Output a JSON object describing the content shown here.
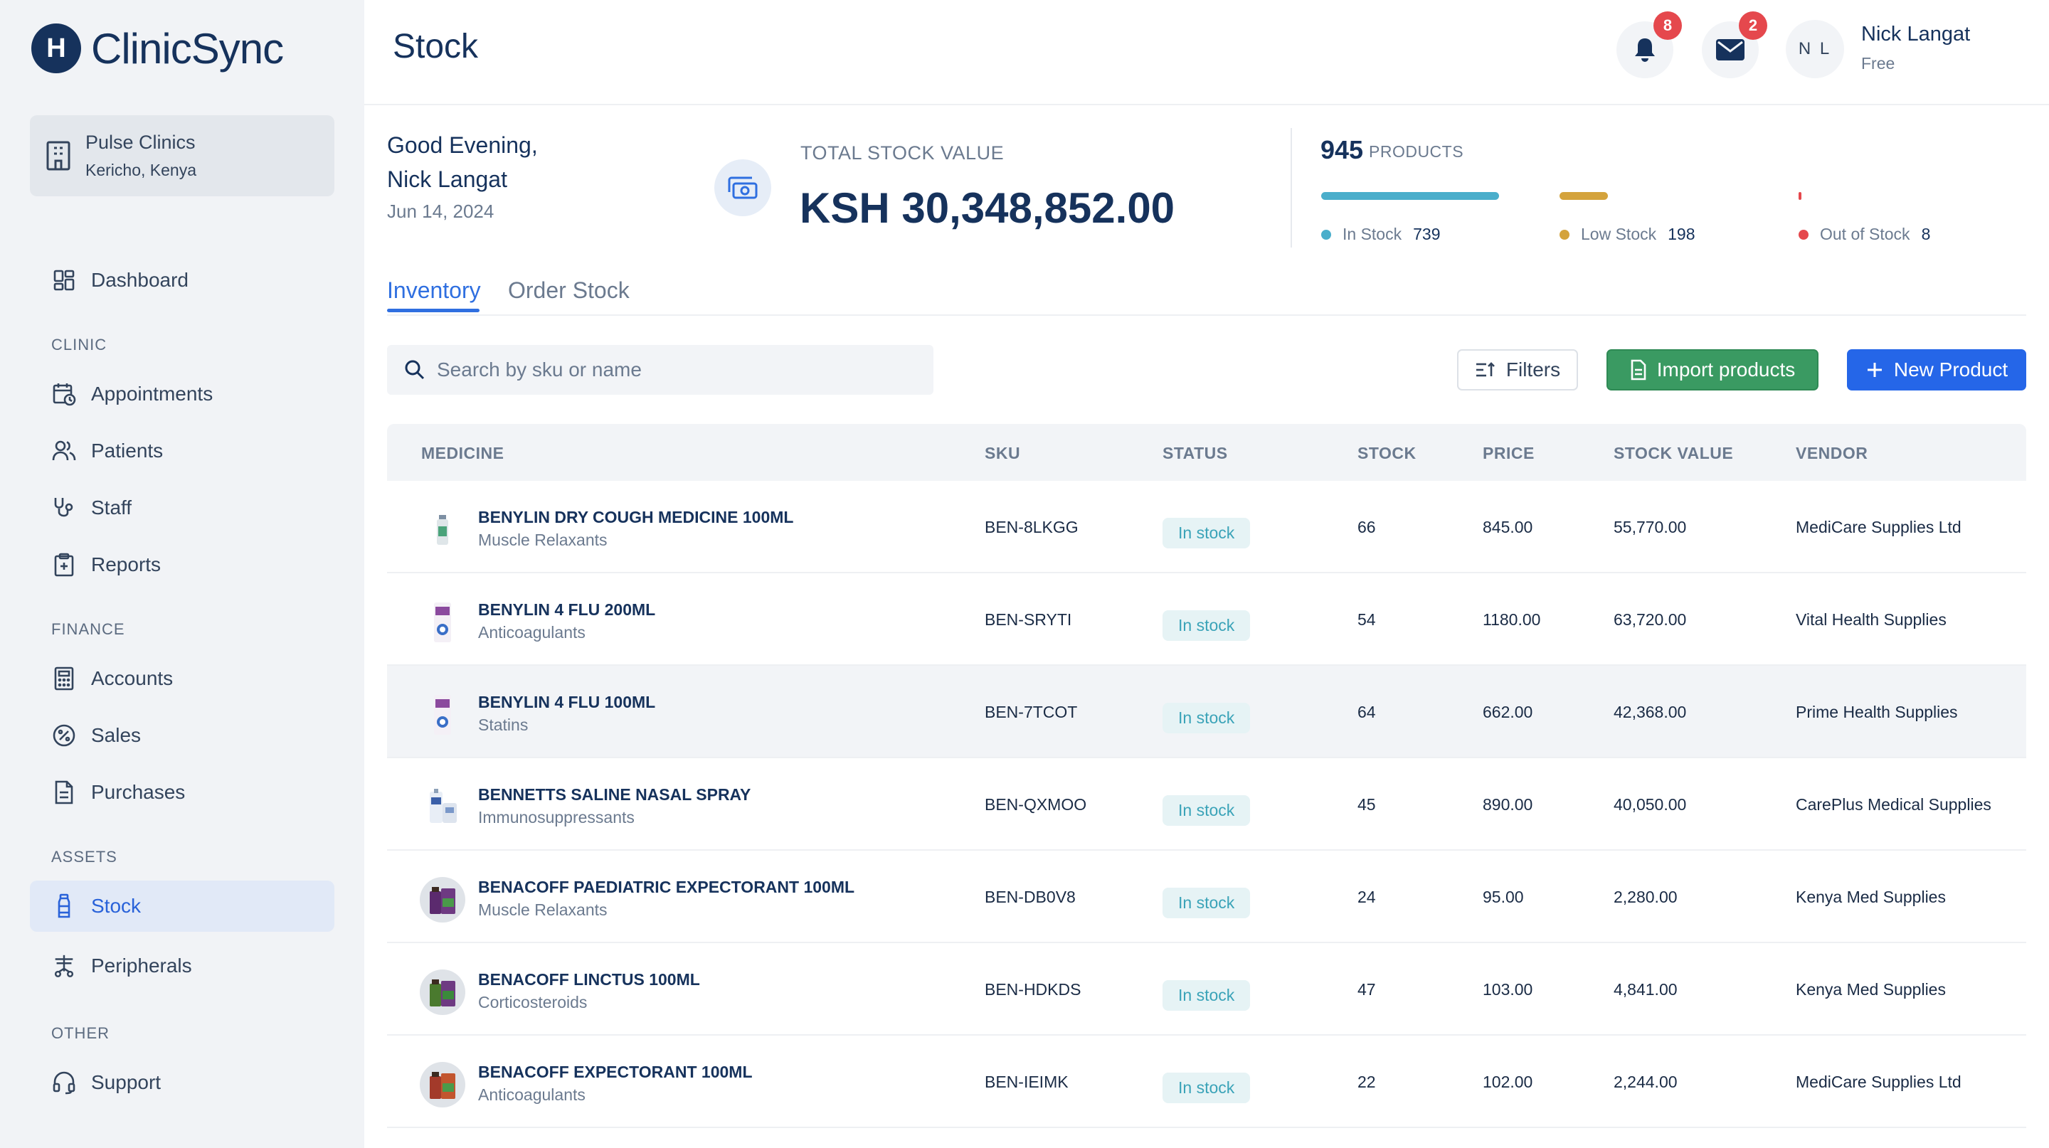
{
  "app": {
    "logo_letter": "H",
    "name": "ClinicSync"
  },
  "clinic": {
    "name": "Pulse Clinics",
    "location": "Kericho, Kenya"
  },
  "nav": {
    "dashboard": "Dashboard",
    "section_clinic": "CLINIC",
    "appointments": "Appointments",
    "patients": "Patients",
    "staff": "Staff",
    "reports": "Reports",
    "section_finance": "FINANCE",
    "accounts": "Accounts",
    "sales": "Sales",
    "purchases": "Purchases",
    "section_assets": "ASSETS",
    "stock": "Stock",
    "peripherals": "Peripherals",
    "section_other": "OTHER",
    "support": "Support"
  },
  "header": {
    "title": "Stock",
    "notifications_count": "8",
    "messages_count": "2",
    "user_initials": "N L",
    "user_name": "Nick Langat",
    "user_plan": "Free"
  },
  "summary": {
    "greeting": "Good Evening,",
    "greeting_name": "Nick Langat",
    "date": "Jun 14, 2024",
    "total_label": "TOTAL STOCK VALUE",
    "total_value": "KSH 30,348,852.00",
    "product_count": "945",
    "product_word": "PRODUCTS",
    "in_stock_label": "In Stock",
    "in_stock_count": "739",
    "low_stock_label": "Low Stock",
    "low_stock_count": "198",
    "out_stock_label": "Out of Stock",
    "out_stock_count": "8"
  },
  "colors": {
    "in_stock": "#4aaecb",
    "low_stock": "#d4a33c",
    "out_stock": "#e5484d",
    "accent": "#2566e8"
  },
  "tabs": {
    "inventory": "Inventory",
    "order": "Order Stock"
  },
  "toolbar": {
    "search_placeholder": "Search by sku or name",
    "filters": "Filters",
    "import": "Import products",
    "new_product": "New Product"
  },
  "table": {
    "headers": {
      "medicine": "MEDICINE",
      "sku": "SKU",
      "status": "STATUS",
      "stock": "STOCK",
      "price": "PRICE",
      "stock_value": "STOCK VALUE",
      "vendor": "VENDOR"
    },
    "rows": [
      {
        "name": "BENYLIN DRY COUGH MEDICINE 100ML",
        "category": "Muscle Relaxants",
        "sku": "BEN-8LKGG",
        "status": "In stock",
        "stock": "66",
        "price": "845.00",
        "value": "55,770.00",
        "vendor": "MediCare Supplies Ltd"
      },
      {
        "name": "BENYLIN 4 FLU 200ML",
        "category": "Anticoagulants",
        "sku": "BEN-SRYTI",
        "status": "In stock",
        "stock": "54",
        "price": "1180.00",
        "value": "63,720.00",
        "vendor": "Vital Health Supplies"
      },
      {
        "name": "BENYLIN 4 FLU 100ML",
        "category": "Statins",
        "sku": "BEN-7TCOT",
        "status": "In stock",
        "stock": "64",
        "price": "662.00",
        "value": "42,368.00",
        "vendor": "Prime Health Supplies"
      },
      {
        "name": "BENNETTS SALINE NASAL SPRAY",
        "category": "Immunosuppressants",
        "sku": "BEN-QXMOO",
        "status": "In stock",
        "stock": "45",
        "price": "890.00",
        "value": "40,050.00",
        "vendor": "CarePlus Medical Supplies"
      },
      {
        "name": "BENACOFF PAEDIATRIC EXPECTORANT 100ML",
        "category": "Muscle Relaxants",
        "sku": "BEN-DB0V8",
        "status": "In stock",
        "stock": "24",
        "price": "95.00",
        "value": "2,280.00",
        "vendor": "Kenya Med Supplies"
      },
      {
        "name": "BENACOFF LINCTUS 100ML",
        "category": "Corticosteroids",
        "sku": "BEN-HDKDS",
        "status": "In stock",
        "stock": "47",
        "price": "103.00",
        "value": "4,841.00",
        "vendor": "Kenya Med Supplies"
      },
      {
        "name": "BENACOFF EXPECTORANT 100ML",
        "category": "Anticoagulants",
        "sku": "BEN-IEIMK",
        "status": "In stock",
        "stock": "22",
        "price": "102.00",
        "value": "2,244.00",
        "vendor": "MediCare Supplies Ltd"
      }
    ]
  }
}
